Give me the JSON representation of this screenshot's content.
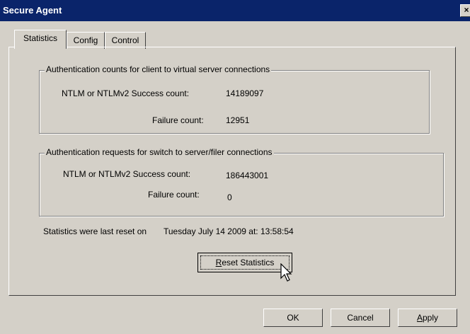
{
  "window": {
    "title": "Secure Agent",
    "close_glyph": "×"
  },
  "tabs": [
    {
      "label": "Statistics",
      "active": true
    },
    {
      "label": "Config",
      "active": false
    },
    {
      "label": "Control",
      "active": false
    }
  ],
  "group_client": {
    "legend": "Authentication counts for client to virtual server connections",
    "success_label": "NTLM or NTLMv2 Success count:",
    "success_value": "14189097",
    "failure_label": "Failure count:",
    "failure_value": "12951"
  },
  "group_switch": {
    "legend": "Authentication requests for switch to server/filer connections",
    "success_label": "NTLM or NTLMv2 Success count:",
    "success_value": "186443001",
    "failure_label": "Failure count:",
    "failure_value": "0"
  },
  "reset": {
    "label": "Statistics were last reset on",
    "value": "Tuesday July 14 2009 at: 13:58:54",
    "button_accel": "R",
    "button_rest": "eset Statistics"
  },
  "footer": {
    "ok": "OK",
    "cancel": "Cancel",
    "apply_accel": "A",
    "apply_rest": "pply"
  },
  "icons": {
    "cursor": "arrow-pointer-icon"
  }
}
